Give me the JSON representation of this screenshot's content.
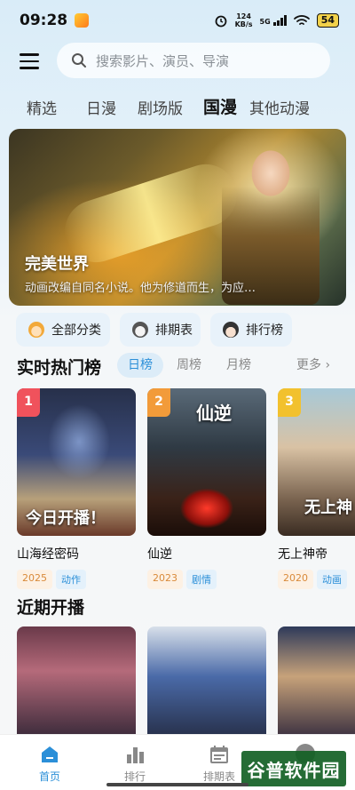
{
  "status_bar": {
    "time": "09:28",
    "net_speed_value": "124",
    "net_speed_unit": "KB/s",
    "network_type": "5G",
    "battery": "54"
  },
  "header": {
    "search_placeholder": "搜索影片、演员、导演"
  },
  "tabs": [
    "精选",
    "日漫",
    "剧场版",
    "国漫",
    "其他动漫"
  ],
  "active_tab": "国漫",
  "banner": {
    "title": "完美世界",
    "description": "动画改编自同名小说。他为修道而生，为应…"
  },
  "quick_links": [
    {
      "label": "全部分类",
      "icon": "all-categories-icon"
    },
    {
      "label": "排期表",
      "icon": "schedule-icon"
    },
    {
      "label": "排行榜",
      "icon": "ranking-icon"
    }
  ],
  "hot_section": {
    "title": "实时热门榜",
    "periods": [
      "日榜",
      "周榜",
      "月榜"
    ],
    "active_period": "日榜",
    "more": "更多"
  },
  "hot_list": [
    {
      "rank": "1",
      "title": "山海经密码",
      "year": "2025",
      "genre": "动作",
      "poster_text": "今日开播！",
      "badge_color": "#f0525c"
    },
    {
      "rank": "2",
      "title": "仙逆",
      "year": "2023",
      "genre": "剧情",
      "poster_text": "仙逆",
      "badge_color": "#f29b3a"
    },
    {
      "rank": "3",
      "title": "无上神帝",
      "year": "2020",
      "genre": "动画",
      "poster_text": "无上神",
      "badge_color": "#f2c12e"
    }
  ],
  "upcoming_section": {
    "title": "近期开播"
  },
  "bottom_nav": [
    {
      "label": "首页",
      "icon": "home-icon",
      "active": true
    },
    {
      "label": "排行",
      "icon": "bar-chart-icon",
      "active": false
    },
    {
      "label": "排期表",
      "icon": "calendar-icon",
      "active": false
    }
  ],
  "watermark": "谷普软件园",
  "colors": {
    "accent": "#2b8fd8",
    "year_tag": "#d98a3a",
    "background": "#f6f7f8"
  }
}
